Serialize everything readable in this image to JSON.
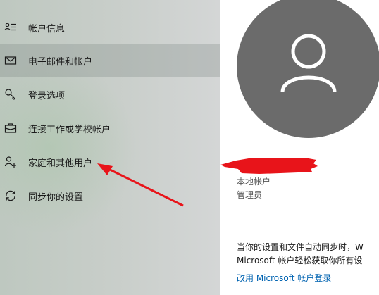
{
  "sidebar": {
    "items": [
      {
        "label": "帐户信息",
        "icon": "account-info-icon"
      },
      {
        "label": "电子邮件和帐户",
        "icon": "mail-icon",
        "selected": true
      },
      {
        "label": "登录选项",
        "icon": "key-icon"
      },
      {
        "label": "连接工作或学校帐户",
        "icon": "briefcase-icon"
      },
      {
        "label": "家庭和其他用户",
        "icon": "add-person-icon"
      },
      {
        "label": "同步你的设置",
        "icon": "sync-icon"
      }
    ]
  },
  "account": {
    "type": "本地帐户",
    "role": "管理员"
  },
  "sync": {
    "line1": "当你的设置和文件自动同步时，W",
    "line2": "Microsoft 帐户轻松获取你所有设",
    "link": "改用 Microsoft 帐户登录"
  },
  "colors": {
    "avatar_bg": "#6b6b6b",
    "link": "#0063b1",
    "annotation": "#e8141a"
  }
}
